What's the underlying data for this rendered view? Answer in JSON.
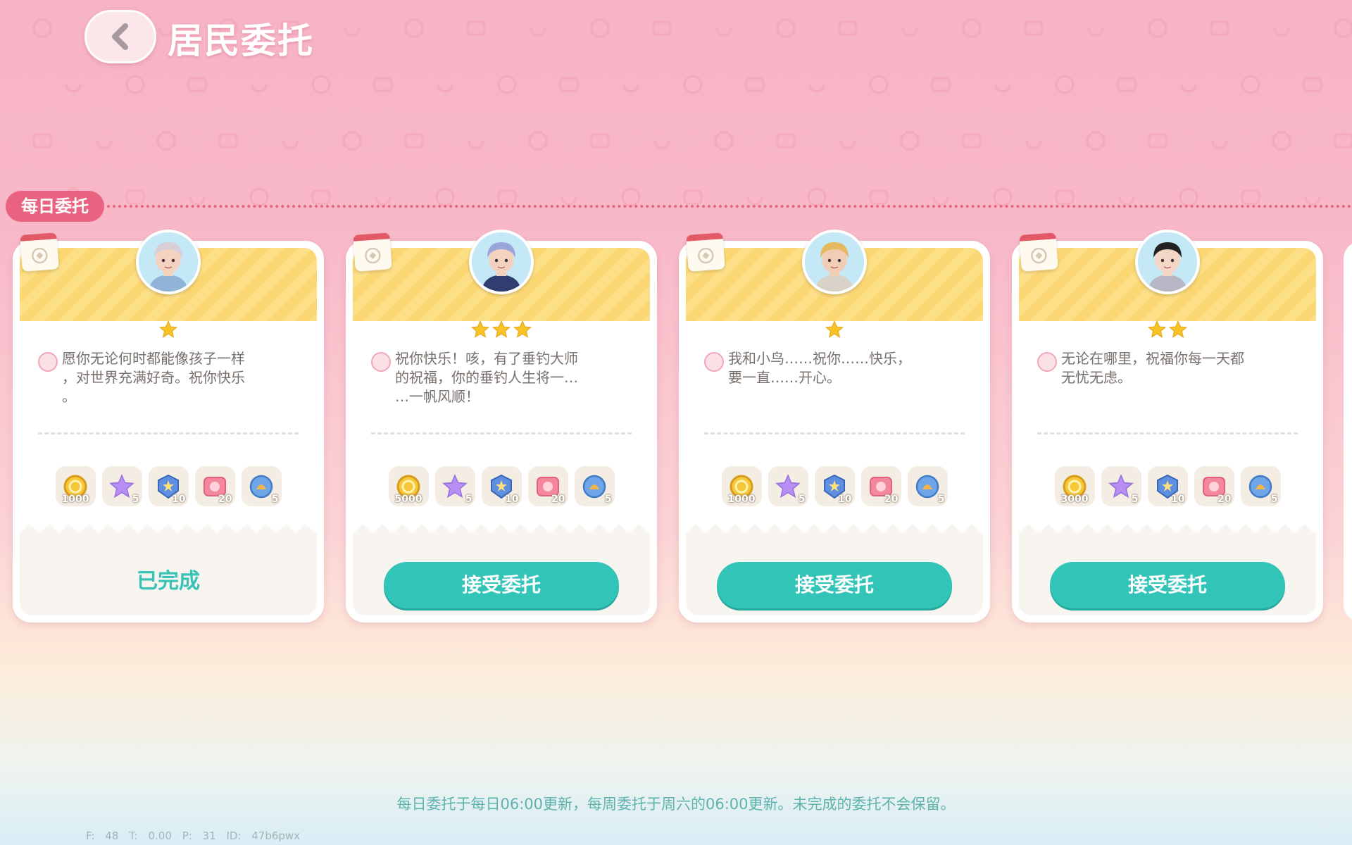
{
  "header": {
    "title": "居民委托",
    "back_icon": "chevron-left-icon"
  },
  "section": {
    "label": "每日委托"
  },
  "cards": [
    {
      "stars": 1,
      "message": "愿你无论何时都能像孩子一样\n，对世界充满好奇。祝你快乐\n。",
      "rewards": [
        {
          "icon": "gold-coin-icon",
          "amount": "1000"
        },
        {
          "icon": "purple-star-icon",
          "amount": "5"
        },
        {
          "icon": "blue-badge-icon",
          "amount": "10"
        },
        {
          "icon": "pink-ticket-icon",
          "amount": "20"
        },
        {
          "icon": "blue-bell-icon",
          "amount": "5"
        }
      ],
      "status": "已完成",
      "completed": true,
      "avatar_colors": {
        "hair": "#d9cdd8",
        "skin": "#f3d2bf",
        "shirt": "#8fb4d8"
      }
    },
    {
      "stars": 3,
      "message": "祝你快乐！咳，有了垂钓大师\n的祝福，你的垂钓人生将一…\n…一帆风顺！",
      "rewards": [
        {
          "icon": "gold-coin-icon",
          "amount": "5000"
        },
        {
          "icon": "purple-star-icon",
          "amount": "5"
        },
        {
          "icon": "blue-badge-icon",
          "amount": "10"
        },
        {
          "icon": "pink-ticket-icon",
          "amount": "20"
        },
        {
          "icon": "blue-bell-icon",
          "amount": "5"
        }
      ],
      "status": "接受委托",
      "completed": false,
      "avatar_colors": {
        "hair": "#9aa6d8",
        "skin": "#f3d2bf",
        "shirt": "#2f3e6e"
      }
    },
    {
      "stars": 1,
      "message": "我和小鸟……祝你……快乐，\n要一直……开心。",
      "rewards": [
        {
          "icon": "gold-coin-icon",
          "amount": "1000"
        },
        {
          "icon": "purple-star-icon",
          "amount": "5"
        },
        {
          "icon": "blue-badge-icon",
          "amount": "10"
        },
        {
          "icon": "pink-ticket-icon",
          "amount": "20"
        },
        {
          "icon": "blue-bell-icon",
          "amount": "5"
        }
      ],
      "status": "接受委托",
      "completed": false,
      "avatar_colors": {
        "hair": "#e6b95e",
        "skin": "#f1cdb6",
        "shirt": "#d9d2c8"
      }
    },
    {
      "stars": 2,
      "message": "无论在哪里，祝福你每一天都\n无忧无虑。",
      "rewards": [
        {
          "icon": "gold-coin-icon",
          "amount": "3000"
        },
        {
          "icon": "purple-star-icon",
          "amount": "5"
        },
        {
          "icon": "blue-badge-icon",
          "amount": "10"
        },
        {
          "icon": "pink-ticket-icon",
          "amount": "20"
        },
        {
          "icon": "blue-bell-icon",
          "amount": "5"
        }
      ],
      "status": "接受委托",
      "completed": false,
      "avatar_colors": {
        "hair": "#222222",
        "skin": "#f3d6c6",
        "shirt": "#b8b6c4"
      }
    }
  ],
  "footer_note": "每日委托于每日06:00更新，每周委托于周六的06:00更新。未完成的委托不会保留。",
  "debug": {
    "f": "F: 48",
    "t": "T: 0.00",
    "p": "P: 31",
    "id": "ID: 47b6pwx"
  },
  "colors": {
    "accent": "#33c4b8",
    "section_tag": "#e9627f",
    "card_header": "#fddf87",
    "star": "#f7c325"
  }
}
